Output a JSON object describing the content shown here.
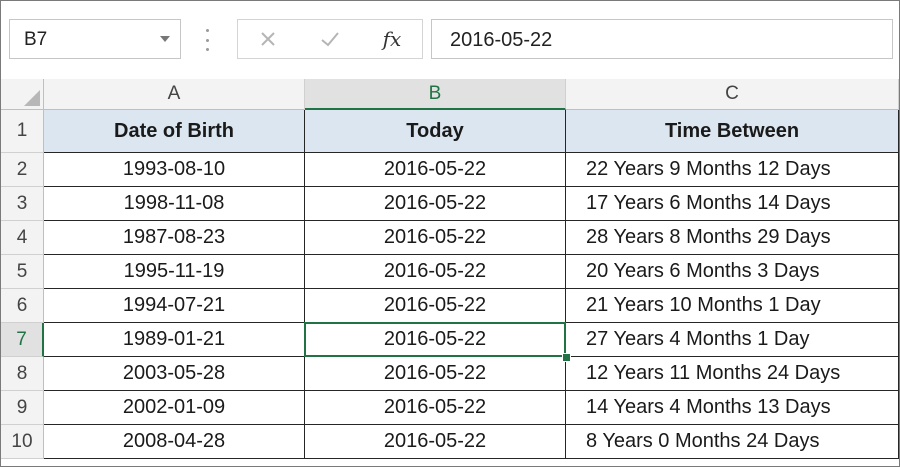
{
  "formula_bar": {
    "name_box": "B7",
    "fx_label": "fx",
    "formula_value": "2016-05-22"
  },
  "icons": {
    "cancel": "close-icon",
    "enter": "checkmark-icon",
    "function": "fx-icon",
    "name_box_dropdown": "chevron-down-icon"
  },
  "colors": {
    "header_fill": "#dce6f1",
    "selection": "#217346",
    "gridline": "#262626"
  },
  "sheet": {
    "columns": [
      "A",
      "B",
      "C"
    ],
    "selected_column": "B",
    "selected_row": 7,
    "rows": [
      {
        "n": "1",
        "a": "Date of Birth",
        "b": "Today",
        "c": "Time Between"
      },
      {
        "n": "2",
        "a": "1993-08-10",
        "b": "2016-05-22",
        "c": "22 Years 9 Months 12 Days"
      },
      {
        "n": "3",
        "a": "1998-11-08",
        "b": "2016-05-22",
        "c": "17 Years 6 Months 14 Days"
      },
      {
        "n": "4",
        "a": "1987-08-23",
        "b": "2016-05-22",
        "c": "28 Years 8 Months 29 Days"
      },
      {
        "n": "5",
        "a": "1995-11-19",
        "b": "2016-05-22",
        "c": "20 Years 6 Months 3 Days"
      },
      {
        "n": "6",
        "a": "1994-07-21",
        "b": "2016-05-22",
        "c": "21 Years 10 Months 1 Day"
      },
      {
        "n": "7",
        "a": "1989-01-21",
        "b": "2016-05-22",
        "c": "27 Years 4 Months 1 Day"
      },
      {
        "n": "8",
        "a": "2003-05-28",
        "b": "2016-05-22",
        "c": "12 Years 11 Months 24 Days"
      },
      {
        "n": "9",
        "a": "2002-01-09",
        "b": "2016-05-22",
        "c": "14 Years 4 Months 13 Days"
      },
      {
        "n": "10",
        "a": "2008-04-28",
        "b": "2016-05-22",
        "c": "8 Years 0 Months 24 Days"
      }
    ]
  }
}
